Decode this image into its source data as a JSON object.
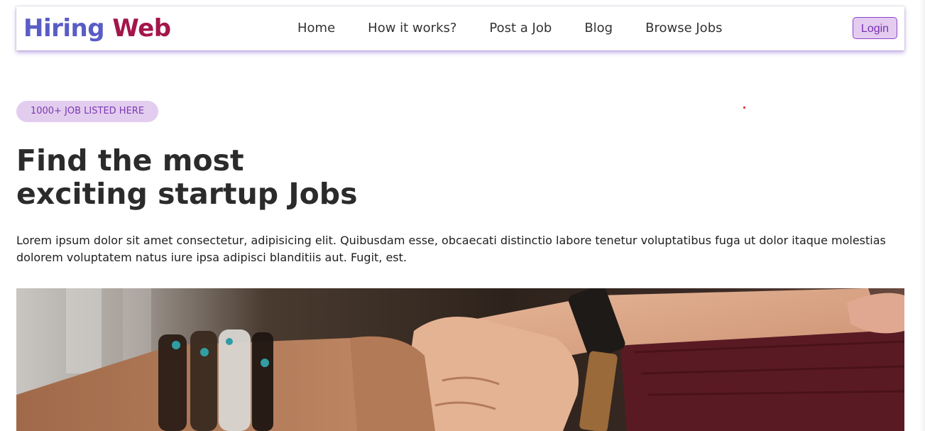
{
  "brand": {
    "part1": "Hiring",
    "part2": "Web"
  },
  "nav": {
    "links": [
      "Home",
      "How it works?",
      "Post a Job",
      "Blog",
      "Browse Jobs"
    ],
    "login_label": "Login"
  },
  "hero": {
    "badge": "1000+ JOB LISTED HERE",
    "headline_line1": "Find the most",
    "headline_line2": "exciting startup Jobs",
    "description": "Lorem ipsum dolor sit amet consectetur, adipisicing elit. Quibusdam esse, obcaecati distinctio labore tenetur voluptatibus fuga ut dolor itaque molestias dolorem voluptatem natus iure ipsa adipisci blanditiis aut. Fugit, est."
  },
  "colors": {
    "brand_primary": "#5a5cc6",
    "brand_secondary": "#a3164a",
    "accent": "#8e44c8",
    "badge_bg": "#e3cdef"
  }
}
